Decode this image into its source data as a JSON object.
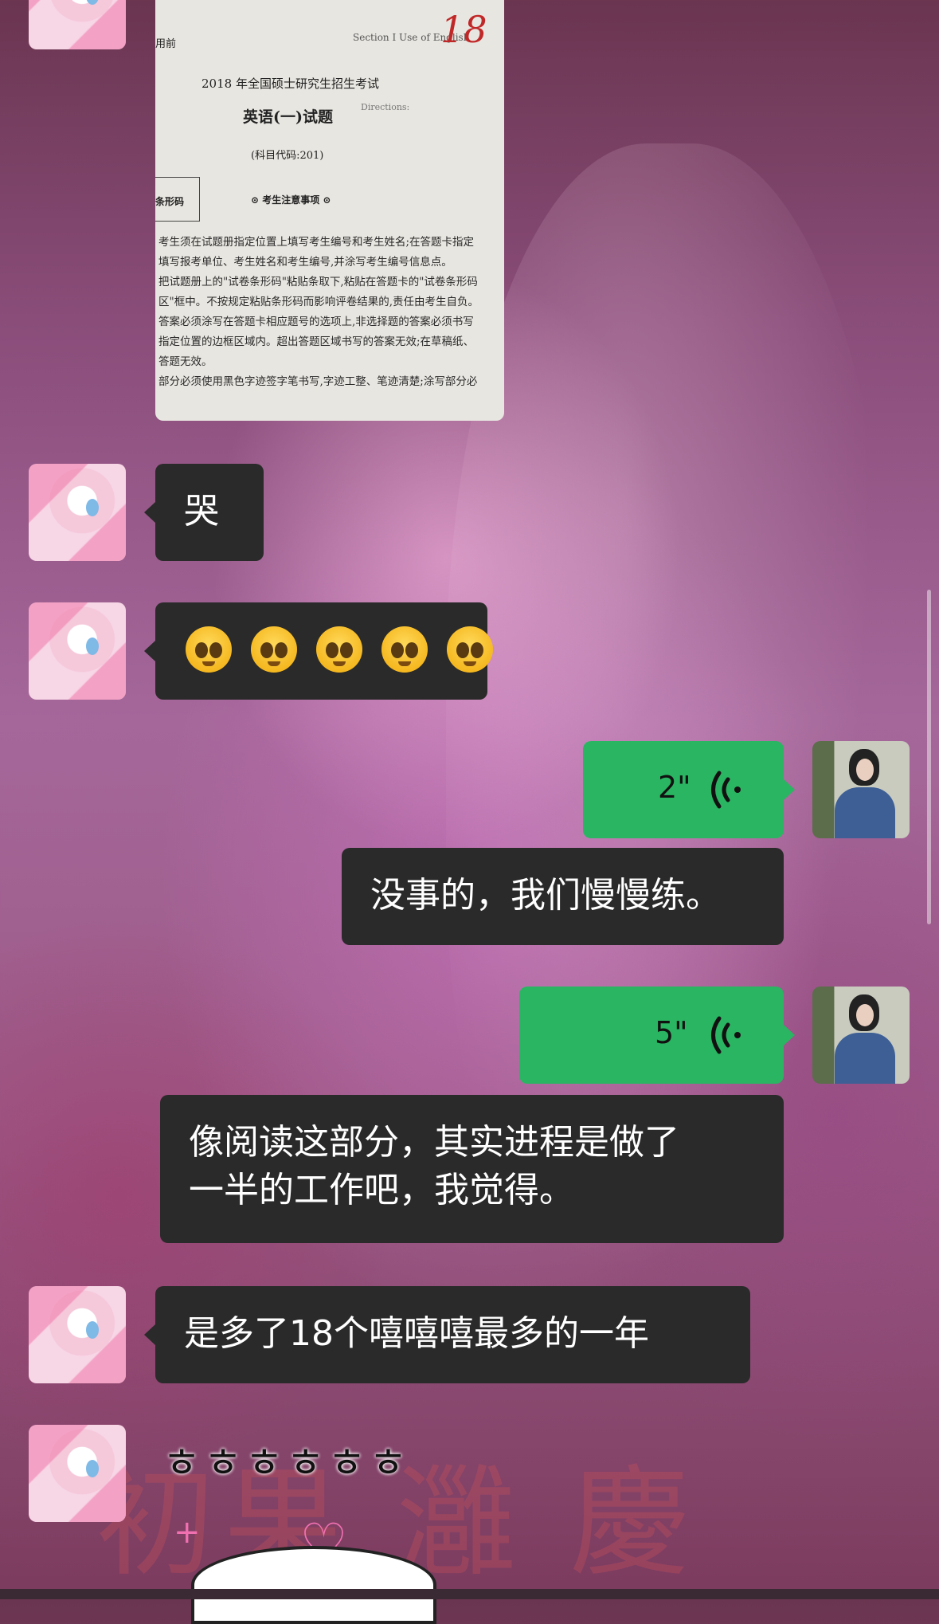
{
  "exam_card": {
    "handwritten": "18",
    "top_left": "用前",
    "top_right": "Section I   Use of English",
    "directions": "Directions:",
    "title_line": "2018 年全国硕士研究生招生考试",
    "subject_title": "英语(一)试题",
    "subject_code": "(科目代码:201)",
    "barcode_label": "条形码",
    "notice_heading": "考生注意事项",
    "body_lines": [
      "考生须在试题册指定位置上填写考生编号和考生姓名;在答题卡指定",
      "填写报考单位、考生姓名和考生编号,并涂写考生编号信息点。",
      "把试题册上的\"试卷条形码\"粘贴条取下,粘贴在答题卡的\"试卷条形码",
      "区\"框中。不按规定粘贴条形码而影响评卷结果的,责任由考生自负。",
      "答案必须涂写在答题卡相应题号的选项上,非选择题的答案必须书写",
      "指定位置的边框区域内。超出答题区域书写的答案无效;在草稿纸、",
      "答题无效。",
      "部分必须使用黑色字迹签字笔书写,字迹工整、笔迹清楚;涂写部分必"
    ]
  },
  "messages": {
    "m1": "哭",
    "m2_emoji": [
      "🥺",
      "🥺",
      "🥺",
      "🥺",
      "🥺"
    ],
    "voice1_duration": "2\"",
    "m3": "没事的，我们慢慢练。",
    "voice2_duration": "5\"",
    "m4_line1": "像阅读这部分，其实进程是做了",
    "m4_line2": "一半的工作吧，我觉得。",
    "m5": "是多了18个嘻嘻嘻最多的一年",
    "sticker_text": "ㅎㅎㅎㅎㅎㅎ"
  },
  "background_text": "初果 灉 慶",
  "icons": {
    "voice": "voice-wave-icon",
    "emoji": "pleading-face-emoji",
    "heart": "heart-icon"
  },
  "colors": {
    "dark_bubble": "#2a2a2a",
    "green_bubble": "#2ab562"
  }
}
